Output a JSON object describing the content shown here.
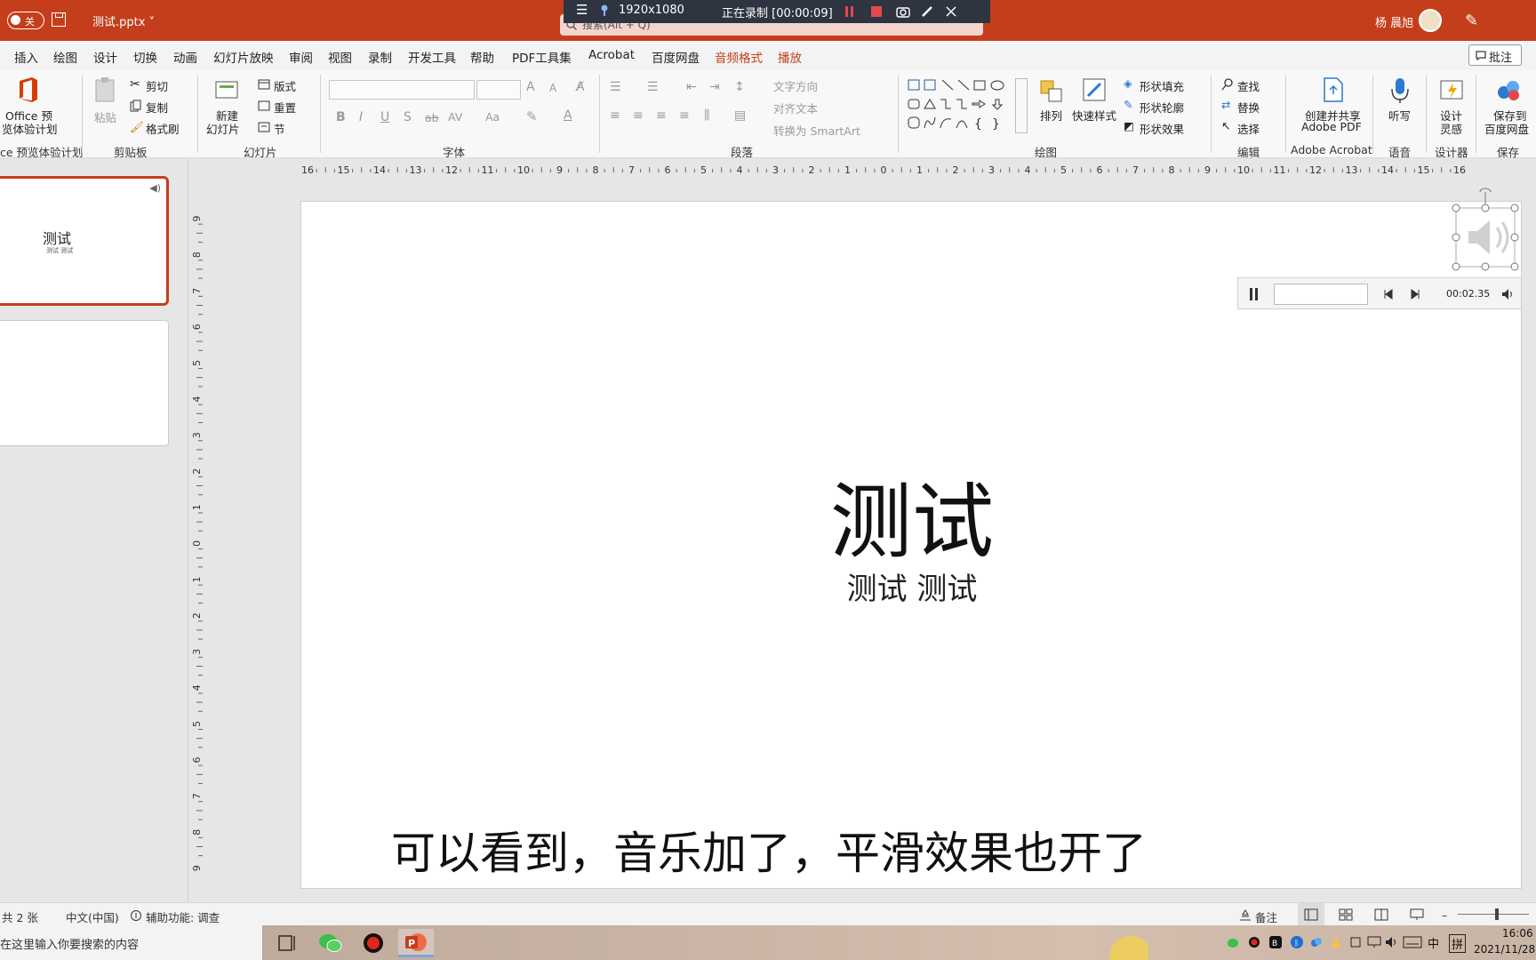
{
  "titlebar": {
    "autosave_label": "关",
    "filename": "测试.pptx ˅",
    "search_hint": "搜索(Alt + Q)",
    "user": "杨 晨旭",
    "recorder": {
      "resolution": "1920x1080",
      "status": "正在录制 [00:00:09]"
    }
  },
  "tabs": [
    "插入",
    "绘图",
    "设计",
    "切换",
    "动画",
    "幻灯片放映",
    "审阅",
    "视图",
    "录制",
    "开发工具",
    "帮助",
    "PDF工具集",
    "Acrobat",
    "百度网盘",
    "音频格式",
    "播放"
  ],
  "comment_label": "批注",
  "ribbon": {
    "office": [
      "Office 预",
      "览体验计划"
    ],
    "office_group": "ce 预览体验计划",
    "clipboard": {
      "paste": "粘贴",
      "cut": "剪切",
      "copy": "复制",
      "painter": "格式刷",
      "group": "剪贴板"
    },
    "slides": {
      "new1": "新建",
      "new2": "幻灯片",
      "layout": "版式",
      "reset": "重置",
      "section": "节",
      "group": "幻灯片"
    },
    "font": {
      "group": "字体",
      "bold": "B",
      "italic": "I",
      "underline": "U",
      "strike": "S",
      "ab": "ab",
      "av": "AV",
      "aa": "Aa",
      "a_up": "A",
      "a_down": "A"
    },
    "para": {
      "direction": "文字方向",
      "align": "对齐文本",
      "smartart": "转换为 SmartArt",
      "group": "段落"
    },
    "drawing": {
      "arrange": "排列",
      "quick": "快速样式",
      "fill": "形状填充",
      "outline": "形状轮廓",
      "effect": "形状效果",
      "group": "绘图"
    },
    "editing": {
      "find": "查找",
      "replace": "替换",
      "select": "选择",
      "group": "编辑"
    },
    "acrobat": {
      "line1": "创建并共享",
      "line2": "Adobe PDF",
      "group": "Adobe Acrobat"
    },
    "voice": {
      "dictate": "听写",
      "group": "语音"
    },
    "designer": {
      "line1": "设计",
      "line2": "灵感",
      "group": "设计器"
    },
    "save": {
      "line1": "保存到",
      "line2": "百度网盘",
      "group": "保存"
    }
  },
  "ruler_h": [
    "16",
    "15",
    "14",
    "13",
    "12",
    "11",
    "10",
    "9",
    "8",
    "7",
    "6",
    "5",
    "4",
    "3",
    "2",
    "1",
    "0",
    "1",
    "2",
    "3",
    "4",
    "5",
    "6",
    "7",
    "8",
    "9",
    "10",
    "11",
    "12",
    "13",
    "14",
    "15",
    "16"
  ],
  "ruler_v": [
    "9",
    "8",
    "7",
    "6",
    "5",
    "4",
    "3",
    "2",
    "1",
    "0",
    "1",
    "2",
    "3",
    "4",
    "5",
    "6",
    "7",
    "8",
    "9"
  ],
  "thumbnails": [
    {
      "title": "测试",
      "sub": "测试 测试"
    }
  ],
  "slide": {
    "title": "测试",
    "subtitle": "测试 测试"
  },
  "player": {
    "time": "00:02.35"
  },
  "caption": "可以看到，音乐加了，平滑效果也开了",
  "status": {
    "slides": "共 2 张",
    "lang": "中文(中国)",
    "access": "辅助功能: 调查",
    "notes": "备注"
  },
  "taskbar": {
    "search": "在这里输入你要搜索的内容",
    "ime1": "中",
    "ime2": "拼",
    "time": "16:06",
    "date": "2021/11/28"
  },
  "colors": {
    "accent": "#c43e1c",
    "recorder": "#2e3440"
  }
}
